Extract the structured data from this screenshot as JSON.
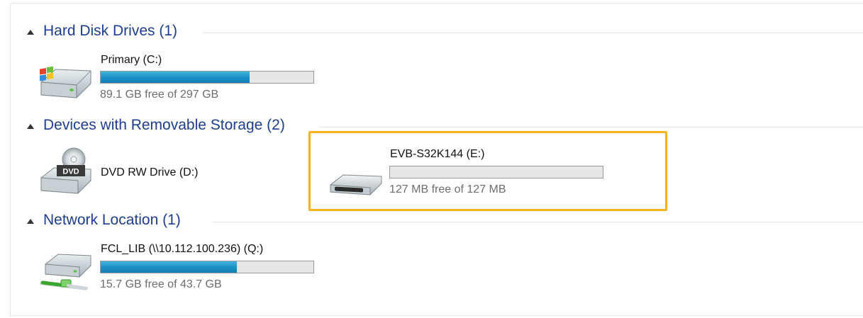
{
  "groups": [
    {
      "title": "Hard Disk Drives (1)"
    },
    {
      "title": "Devices with Removable Storage (2)"
    },
    {
      "title": "Network Location (1)"
    }
  ],
  "drives": [
    {
      "name": "Primary (C:)",
      "free": "89.1 GB free of 297 GB",
      "used_fraction": 0.7,
      "icon": "hard-disk-windows-icon"
    },
    {
      "name": "DVD RW Drive (D:)",
      "icon": "dvd-drive-icon",
      "icon_label": "DVD"
    },
    {
      "name": "EVB-S32K144 (E:)",
      "free": "127 MB free of 127 MB",
      "used_fraction": 0.0,
      "icon": "removable-drive-icon"
    },
    {
      "name": "FCL_LIB (\\\\10.112.100.236) (Q:)",
      "free": "15.7 GB free of 43.7 GB",
      "used_fraction": 0.64,
      "icon": "network-drive-icon"
    }
  ],
  "colors": {
    "group_title": "#1f3d8f",
    "highlight": "#f4b41a",
    "bar_fill": "#1c8fc4"
  }
}
